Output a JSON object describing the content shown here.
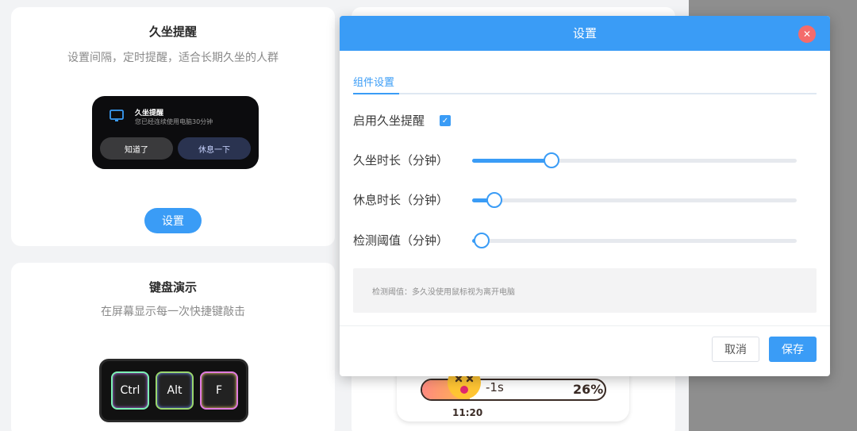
{
  "cards": {
    "sedentary": {
      "title": "久坐提醒",
      "desc": "设置间隔，定时提醒，适合长期久坐的人群",
      "widget": {
        "title": "久坐提醒",
        "text": "您已经连续使用电脑30分钟",
        "btn_know": "知道了",
        "btn_rest": "休息一下"
      },
      "settings_btn": "设置"
    },
    "keyboard": {
      "title": "键盘演示",
      "desc": "在屏幕显示每一次快捷键敲击",
      "keys": [
        "Ctrl",
        "Alt",
        "F"
      ]
    },
    "drink": {
      "time_left": "-1s",
      "percent": "26%",
      "percent_value": 26,
      "clock": "11:20"
    }
  },
  "modal": {
    "title": "设置",
    "close_icon": "close-icon",
    "tab": "组件设置",
    "enable_label": "启用久坐提醒",
    "enabled": true,
    "sliders": [
      {
        "label": "久坐时长（分钟）",
        "fraction": 0.245
      },
      {
        "label": "休息时长（分钟）",
        "fraction": 0.068
      },
      {
        "label": "检测阈值（分钟）",
        "fraction": 0.03
      }
    ],
    "hint": "检测阈值：多久没使用鼠标视为离开电脑",
    "cancel": "取消",
    "save": "保存"
  },
  "colors": {
    "accent": "#3a9cf6",
    "close": "#f46b6b"
  }
}
